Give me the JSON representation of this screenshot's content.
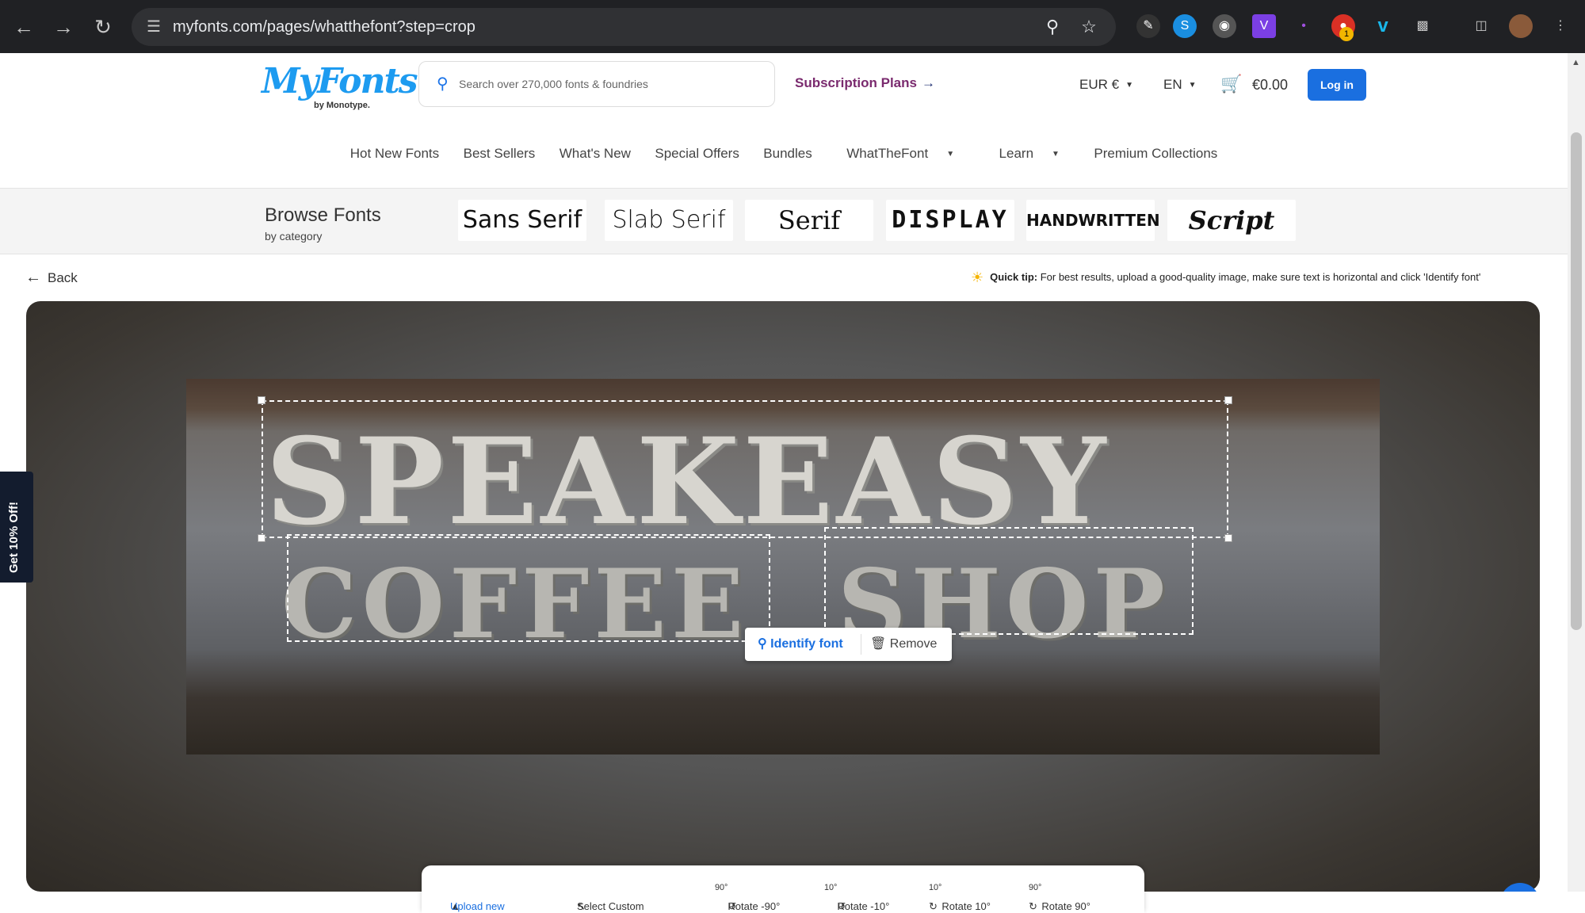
{
  "browser": {
    "url": "myfonts.com/pages/whatthefont?step=crop",
    "ext_badge": "1"
  },
  "header": {
    "logo_text": "MyFonts",
    "logo_sub": "by Monotype.",
    "search_placeholder": "Search over 270,000 fonts & foundries",
    "subscription": "Subscription Plans",
    "currency": "EUR €",
    "language": "EN",
    "cart_total": "€0.00",
    "login": "Log in"
  },
  "menu": {
    "items": [
      "Hot New Fonts",
      "Best Sellers",
      "What's New",
      "Special Offers",
      "Bundles",
      "WhatTheFont",
      "Learn",
      "Premium Collections"
    ]
  },
  "browse": {
    "title": "Browse Fonts",
    "subtitle": "by category",
    "categories": [
      "Sans Serif",
      "Slab Serif",
      "Serif",
      "DISPLAY",
      "HANDWRITTEN",
      "Script"
    ]
  },
  "page": {
    "back": "Back",
    "tip_label": "Quick tip:",
    "tip_text": "For best results, upload a good-quality image, make sure text is horizontal and click 'Identify font'"
  },
  "image": {
    "line1": "SPEAKEASY",
    "line2": "COFFEE",
    "line3": "SHOP"
  },
  "crop_actions": {
    "identify": "Identify font",
    "remove": "Remove"
  },
  "toolbar": {
    "upload": "Upload new",
    "select": "Select Custom",
    "rot_m90_badge": "90°",
    "rot_m90": "Rotate -90°",
    "rot_m10_badge": "10°",
    "rot_m10": "Rotate -10°",
    "rot_p10_badge": "10°",
    "rot_p10": "Rotate 10°",
    "rot_p90_badge": "90°",
    "rot_p90": "Rotate 90°"
  },
  "promo": "Get 10% Off!",
  "icons": {
    "back": "arrow-left-icon",
    "forward": "arrow-right-icon",
    "reload": "reload-icon",
    "zoom": "zoom-icon",
    "star": "star-icon",
    "cart": "cart-icon",
    "chat": "chat-icon"
  },
  "colors": {
    "accent": "#1a6fe0",
    "subscription": "#7a2a6e",
    "logo": "#1d9bf0"
  }
}
